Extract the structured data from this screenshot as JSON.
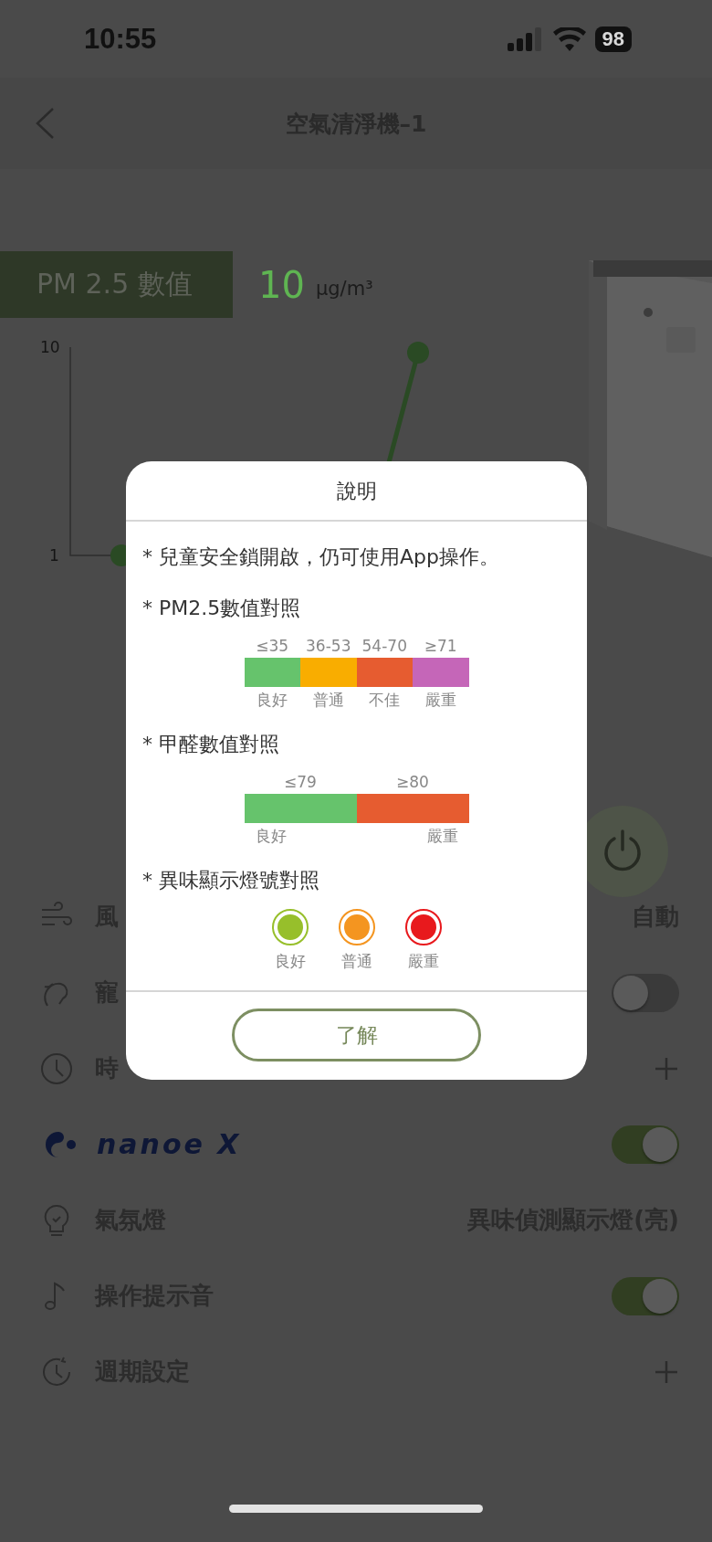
{
  "status_bar": {
    "time": "10:55",
    "battery": "98"
  },
  "nav": {
    "title": "空氣清淨機–1"
  },
  "pm": {
    "label": "PM 2.5 數值",
    "value": "10",
    "unit": "µg/m³"
  },
  "chart": {
    "y_labels": [
      "10",
      "1"
    ]
  },
  "settings": [
    {
      "kind": "value",
      "label": "風",
      "value": "自動"
    },
    {
      "kind": "toggle",
      "label": "寵",
      "on": false
    },
    {
      "kind": "add",
      "label": "時"
    },
    {
      "kind": "logo-toggle",
      "label": "nanoe X",
      "on": true
    },
    {
      "kind": "value",
      "label": "氣氛燈",
      "value": "異味偵測顯示燈(亮)"
    },
    {
      "kind": "toggle",
      "label": "操作提示音",
      "on": true
    },
    {
      "kind": "add",
      "label": "週期設定"
    }
  ],
  "dialog": {
    "title": "說明",
    "sections": [
      {
        "kind": "note",
        "text": "* 兒童安全鎖開啟，仍可使用App操作。"
      },
      {
        "kind": "scale",
        "heading": "* PM2.5數值對照",
        "segments": [
          {
            "range": "≤35",
            "label": "良好",
            "color": "#66c36c"
          },
          {
            "range": "36-53",
            "label": "普通",
            "color": "#f9ad00"
          },
          {
            "range": "54-70",
            "label": "不佳",
            "color": "#e65c30"
          },
          {
            "range": "≥71",
            "label": "嚴重",
            "color": "#c566b8"
          }
        ]
      },
      {
        "kind": "scale",
        "heading": "* 甲醛數值對照",
        "segments": [
          {
            "range": "≤79",
            "label": "良好",
            "color": "#66c36c"
          },
          {
            "range": "≥80",
            "label": "嚴重",
            "color": "#e65c30"
          }
        ]
      },
      {
        "kind": "lamps",
        "heading": "* 異味顯示燈號對照",
        "lamps": [
          {
            "label": "良好",
            "color": "#97bf2b"
          },
          {
            "label": "普通",
            "color": "#f49520"
          },
          {
            "label": "嚴重",
            "color": "#e8191d"
          }
        ]
      }
    ],
    "button": "了解"
  }
}
